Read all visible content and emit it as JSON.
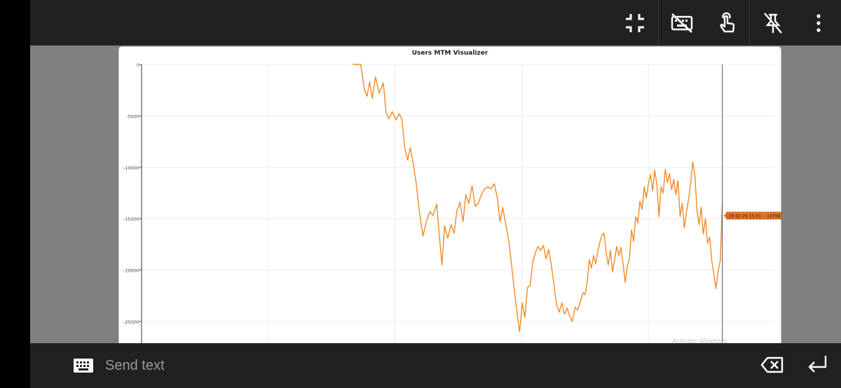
{
  "toolbar": {
    "icons": [
      "exit-fullscreen-icon",
      "keyboard-off-icon",
      "touch-mode-icon",
      "unpin-icon",
      "more-vert-icon"
    ]
  },
  "chart_window": {
    "watermark": "Activate Windows"
  },
  "chart_data": {
    "type": "line",
    "title": "Users MTM Visualizer",
    "xlabel": "",
    "ylabel": "",
    "ylim": [
      -27000,
      0
    ],
    "yticks": [
      0,
      -5000,
      -10000,
      -15000,
      -20000,
      -25000
    ],
    "ytick_labels": [
      "0",
      "-5000",
      "-10000",
      "-15000",
      "-20000",
      "-25000"
    ],
    "x_range": [
      0,
      100
    ],
    "grid": true,
    "series": [
      {
        "color": "#f08a24",
        "points": [
          [
            40.0,
            0
          ],
          [
            41.5,
            0
          ],
          [
            42.2,
            -2400
          ],
          [
            42.7,
            -3100
          ],
          [
            43.2,
            -1700
          ],
          [
            43.7,
            -3300
          ],
          [
            44.3,
            -1200
          ],
          [
            45.0,
            -2800
          ],
          [
            45.8,
            -1800
          ],
          [
            46.3,
            -4600
          ],
          [
            46.8,
            -5300
          ],
          [
            47.5,
            -4600
          ],
          [
            48.2,
            -5400
          ],
          [
            48.8,
            -4800
          ],
          [
            49.3,
            -5300
          ],
          [
            49.9,
            -8300
          ],
          [
            50.4,
            -9300
          ],
          [
            50.9,
            -8100
          ],
          [
            51.5,
            -9800
          ],
          [
            52.0,
            -11500
          ],
          [
            52.7,
            -14600
          ],
          [
            53.3,
            -16700
          ],
          [
            54.0,
            -15200
          ],
          [
            54.6,
            -14300
          ],
          [
            55.2,
            -14700
          ],
          [
            55.9,
            -13600
          ],
          [
            56.4,
            -16600
          ],
          [
            56.9,
            -19500
          ],
          [
            57.4,
            -15700
          ],
          [
            58.0,
            -16900
          ],
          [
            58.6,
            -15600
          ],
          [
            59.2,
            -16400
          ],
          [
            59.7,
            -14300
          ],
          [
            60.3,
            -13400
          ],
          [
            60.9,
            -15300
          ],
          [
            61.4,
            -12700
          ],
          [
            62.0,
            -13500
          ],
          [
            62.6,
            -11800
          ],
          [
            63.2,
            -13800
          ],
          [
            63.8,
            -13500
          ],
          [
            64.4,
            -12600
          ],
          [
            65.0,
            -12100
          ],
          [
            65.6,
            -11900
          ],
          [
            66.2,
            -12100
          ],
          [
            66.8,
            -11600
          ],
          [
            67.4,
            -13000
          ],
          [
            67.9,
            -15300
          ],
          [
            68.4,
            -13900
          ],
          [
            69.0,
            -15600
          ],
          [
            69.6,
            -17300
          ],
          [
            70.1,
            -19600
          ],
          [
            70.6,
            -22000
          ],
          [
            71.1,
            -24100
          ],
          [
            71.6,
            -26000
          ],
          [
            72.1,
            -23200
          ],
          [
            72.6,
            -24600
          ],
          [
            73.1,
            -21700
          ],
          [
            73.6,
            -21500
          ],
          [
            74.1,
            -19200
          ],
          [
            74.6,
            -18300
          ],
          [
            75.1,
            -17700
          ],
          [
            75.6,
            -18100
          ],
          [
            76.1,
            -17600
          ],
          [
            76.6,
            -18900
          ],
          [
            77.1,
            -18000
          ],
          [
            77.6,
            -19500
          ],
          [
            78.1,
            -21400
          ],
          [
            78.6,
            -23400
          ],
          [
            79.1,
            -24100
          ],
          [
            79.6,
            -23200
          ],
          [
            80.1,
            -24300
          ],
          [
            80.6,
            -23700
          ],
          [
            81.1,
            -24500
          ],
          [
            81.6,
            -25000
          ],
          [
            82.1,
            -23600
          ],
          [
            82.6,
            -23900
          ],
          [
            83.1,
            -23100
          ],
          [
            83.6,
            -22200
          ],
          [
            84.0,
            -22400
          ],
          [
            84.4,
            -21200
          ],
          [
            84.8,
            -19000
          ],
          [
            85.2,
            -19800
          ],
          [
            85.6,
            -18600
          ],
          [
            86.0,
            -19400
          ],
          [
            86.4,
            -18200
          ],
          [
            86.8,
            -17300
          ],
          [
            87.2,
            -16600
          ],
          [
            87.6,
            -16400
          ],
          [
            88.0,
            -18300
          ],
          [
            88.4,
            -19500
          ],
          [
            88.8,
            -18100
          ],
          [
            89.2,
            -20200
          ],
          [
            89.6,
            -19000
          ],
          [
            90.0,
            -17700
          ],
          [
            90.4,
            -18600
          ],
          [
            90.8,
            -17800
          ],
          [
            91.2,
            -19400
          ],
          [
            91.6,
            -21200
          ],
          [
            92.0,
            -19600
          ],
          [
            92.4,
            -18900
          ],
          [
            92.8,
            -16100
          ],
          [
            93.2,
            -17200
          ],
          [
            93.6,
            -14800
          ],
          [
            94.0,
            -15400
          ],
          [
            94.4,
            -13300
          ],
          [
            94.8,
            -14100
          ],
          [
            95.2,
            -11900
          ],
          [
            95.6,
            -13000
          ],
          [
            96.0,
            -11600
          ],
          [
            96.4,
            -10700
          ],
          [
            96.8,
            -12300
          ],
          [
            97.2,
            -10300
          ],
          [
            97.6,
            -11700
          ],
          [
            98.0,
            -14800
          ],
          [
            98.4,
            -11900
          ],
          [
            98.8,
            -12500
          ],
          [
            99.2,
            -10200
          ],
          [
            99.6,
            -11500
          ],
          [
            100.0,
            -10600
          ],
          [
            100.4,
            -12200
          ],
          [
            100.8,
            -11200
          ],
          [
            101.2,
            -12700
          ],
          [
            101.6,
            -11300
          ],
          [
            102.0,
            -14800
          ],
          [
            102.4,
            -13500
          ],
          [
            102.8,
            -15900
          ],
          [
            103.2,
            -14400
          ],
          [
            103.6,
            -13100
          ],
          [
            104.0,
            -11500
          ],
          [
            104.4,
            -9500
          ],
          [
            104.8,
            -10800
          ],
          [
            105.2,
            -14200
          ],
          [
            105.6,
            -15600
          ],
          [
            106.0,
            -13900
          ],
          [
            106.4,
            -16500
          ],
          [
            106.8,
            -15000
          ],
          [
            107.2,
            -17400
          ],
          [
            107.6,
            -16800
          ],
          [
            108.0,
            -19100
          ],
          [
            108.4,
            -20400
          ],
          [
            108.8,
            -21800
          ],
          [
            109.2,
            -20100
          ],
          [
            109.6,
            -19100
          ],
          [
            110.0,
            -13500
          ]
        ]
      }
    ],
    "cursor": {
      "x": 110.0,
      "label": "26-02-26 15:01 : -14708"
    },
    "xlim": [
      0,
      120
    ]
  }
}
